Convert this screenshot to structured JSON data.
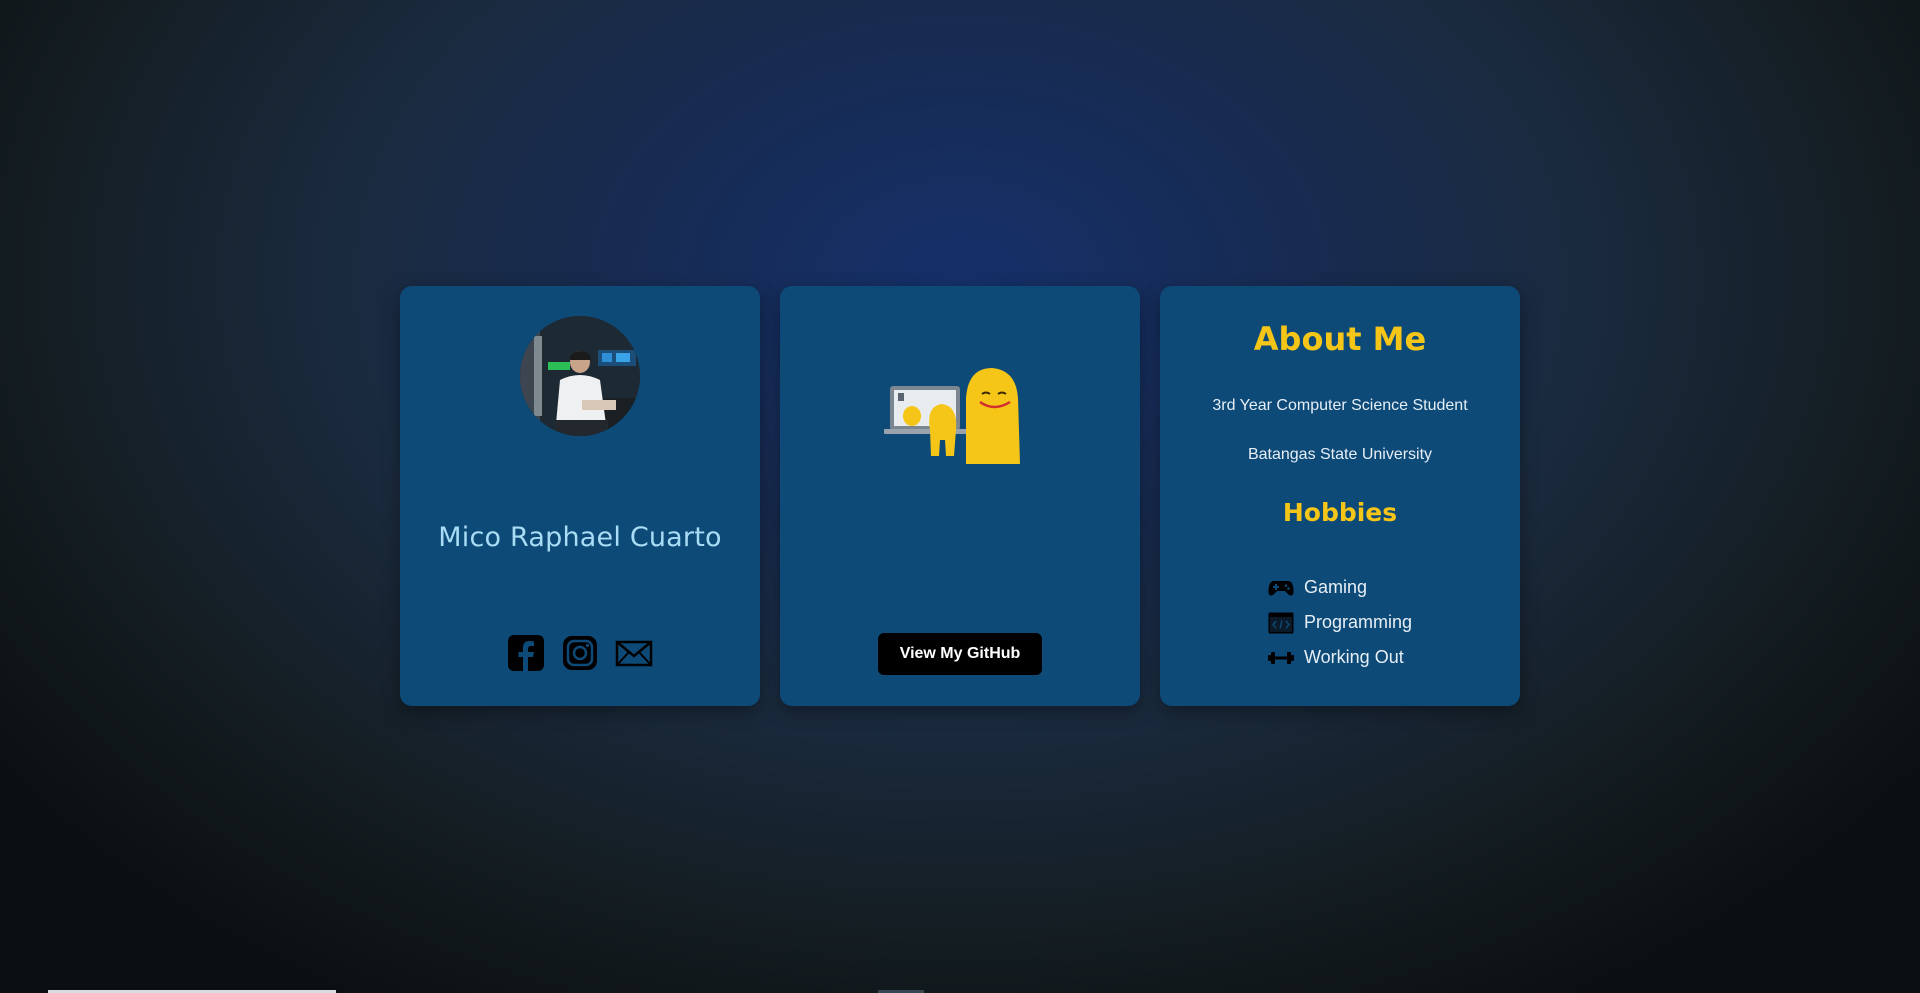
{
  "profile": {
    "name": "Mico Raphael Cuarto",
    "avatar_alt": "Profile photo",
    "socials": [
      {
        "icon": "facebook-icon"
      },
      {
        "icon": "instagram-icon"
      },
      {
        "icon": "mail-icon"
      }
    ]
  },
  "github": {
    "button_label": "View My GitHub",
    "illustration_icon": "coding-character-illustration"
  },
  "about": {
    "title": "About Me",
    "line1": "3rd Year Computer Science Student",
    "line2": "Batangas State University",
    "hobbies_title": "Hobbies",
    "hobbies": [
      {
        "label": "Gaming",
        "icon": "gamepad-icon"
      },
      {
        "label": "Programming",
        "icon": "code-window-icon"
      },
      {
        "label": "Working Out",
        "icon": "dumbbell-icon"
      }
    ]
  },
  "colors": {
    "card": "#0d4a77",
    "accent": "#f5c518",
    "name": "#a9dcf5",
    "button": "#000000"
  }
}
